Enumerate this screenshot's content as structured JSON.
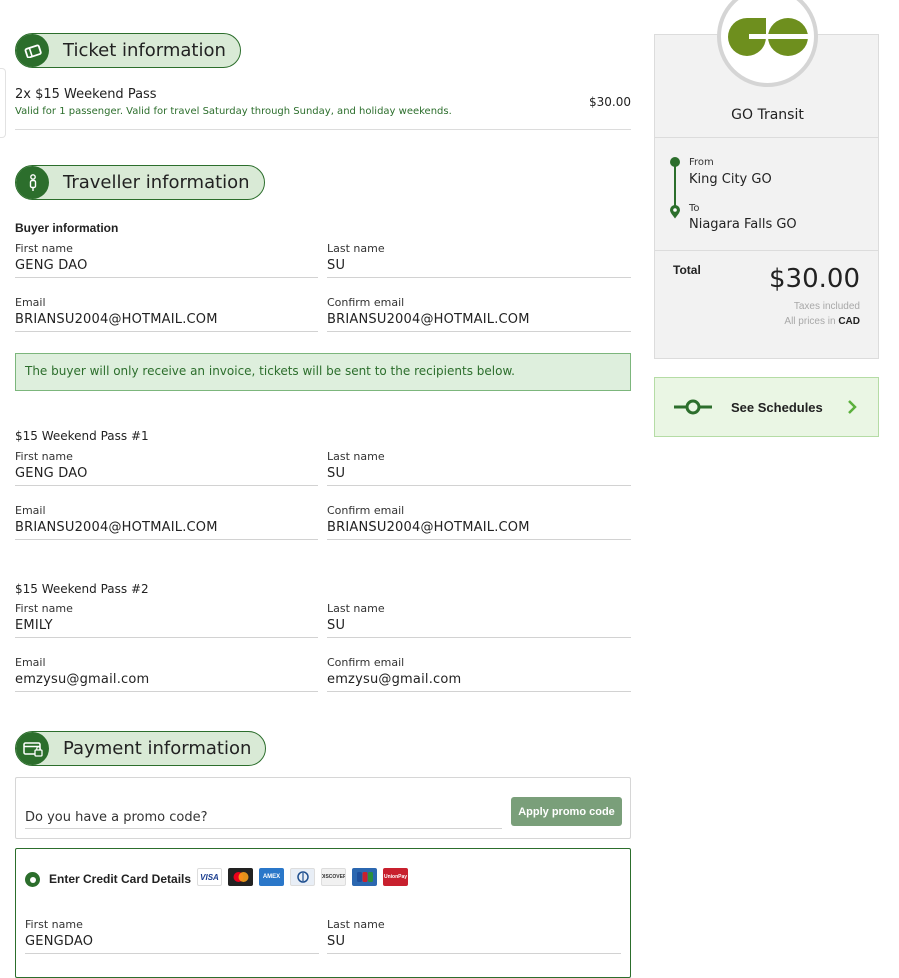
{
  "ticket_section": {
    "title": "Ticket information",
    "item_name": "2x $15 Weekend Pass",
    "item_desc": "Valid for 1 passenger. Valid for travel Saturday through Sunday, and holiday weekends.",
    "item_price": "$30.00"
  },
  "traveller_section": {
    "title": "Traveller information",
    "buyer_heading": "Buyer information",
    "buyer": {
      "first_name_label": "First name",
      "first_name": "GENG DAO",
      "last_name_label": "Last name",
      "last_name": "SU",
      "email_label": "Email",
      "email": "BRIANSU2004@HOTMAIL.COM",
      "confirm_email_label": "Confirm email",
      "confirm_email": "BRIANSU2004@HOTMAIL.COM"
    },
    "notice": "The buyer will only receive an invoice, tickets will be sent to the recipients below.",
    "passes": [
      {
        "heading": "$15 Weekend Pass #1",
        "first_name_label": "First name",
        "first_name": "GENG DAO",
        "last_name_label": "Last name",
        "last_name": "SU",
        "email_label": "Email",
        "email": "BRIANSU2004@HOTMAIL.COM",
        "confirm_email_label": "Confirm email",
        "confirm_email": "BRIANSU2004@HOTMAIL.COM"
      },
      {
        "heading": "$15 Weekend Pass #2",
        "first_name_label": "First name",
        "first_name": "EMILY",
        "last_name_label": "Last name",
        "last_name": "SU",
        "email_label": "Email",
        "email": "emzysu@gmail.com",
        "confirm_email_label": "Confirm email",
        "confirm_email": "emzysu@gmail.com"
      }
    ]
  },
  "payment_section": {
    "title": "Payment information",
    "promo_placeholder": "Do you have a promo code?",
    "promo_button": "Apply promo code",
    "card_option_label": "Enter Credit Card Details",
    "card_brands": [
      {
        "name": "VISA",
        "color": "#1a3d8f"
      },
      {
        "name": "MC",
        "color": "#222222"
      },
      {
        "name": "AMEX",
        "color": "#2a77c9"
      },
      {
        "name": "DINERS",
        "color": "#e8eef6"
      },
      {
        "name": "DISCOVER",
        "color": "#f1f1f1"
      },
      {
        "name": "JCB",
        "color": "#2b67b0"
      },
      {
        "name": "UnionPay",
        "color": "#c8202e"
      }
    ],
    "first_name_label": "First name",
    "first_name": "GENGDAO",
    "last_name_label": "Last name",
    "last_name": "SU"
  },
  "sidebar": {
    "brand": "GO Transit",
    "from_label": "From",
    "from": "King City GO",
    "to_label": "To",
    "to": "Niagara Falls GO",
    "total_label": "Total",
    "total": "$30.00",
    "taxes": "Taxes included",
    "prices_in": "All prices in",
    "currency": "CAD",
    "schedules_label": "See Schedules"
  },
  "colors": {
    "brand_green": "#2c6e2c",
    "logo_green": "#6e8f1e",
    "pill_bg": "#d9ead6"
  }
}
